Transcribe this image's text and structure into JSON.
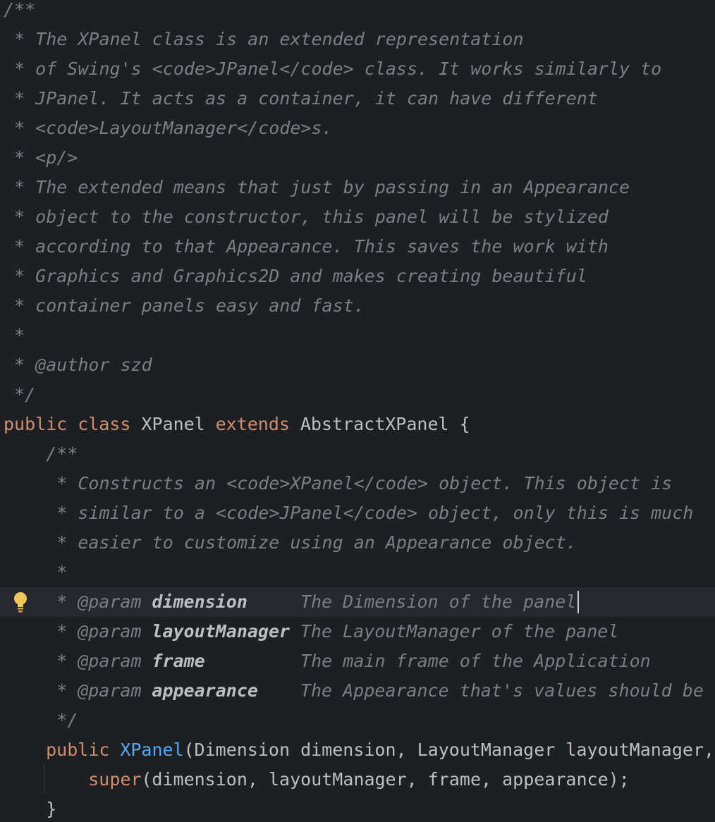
{
  "editor": {
    "language": "Java",
    "lines": [
      {
        "segments": [
          {
            "kind": "doc",
            "text": "/**"
          }
        ]
      },
      {
        "segments": [
          {
            "kind": "doc",
            "text": " * The XPanel class is an extended representation"
          }
        ]
      },
      {
        "segments": [
          {
            "kind": "doc",
            "text": " * of Swing's <code>JPanel</code> class. It works similarly to"
          }
        ]
      },
      {
        "segments": [
          {
            "kind": "doc",
            "text": " * JPanel. It acts as a container, it can have different"
          }
        ]
      },
      {
        "segments": [
          {
            "kind": "doc",
            "text": " * <code>LayoutManager</code>s."
          }
        ]
      },
      {
        "segments": [
          {
            "kind": "doc",
            "text": " * <p/>"
          }
        ]
      },
      {
        "segments": [
          {
            "kind": "doc",
            "text": " * The extended means that just by passing in an Appearance"
          }
        ]
      },
      {
        "segments": [
          {
            "kind": "doc",
            "text": " * object to the constructor, this panel will be stylized"
          }
        ]
      },
      {
        "segments": [
          {
            "kind": "doc",
            "text": " * according to that Appearance. This saves the work with"
          }
        ]
      },
      {
        "segments": [
          {
            "kind": "doc",
            "text": " * Graphics and Graphics2D and makes creating beautiful"
          }
        ]
      },
      {
        "segments": [
          {
            "kind": "doc",
            "text": " * container panels easy and fast."
          }
        ]
      },
      {
        "segments": [
          {
            "kind": "doc",
            "text": " *"
          }
        ]
      },
      {
        "segments": [
          {
            "kind": "doc",
            "text": " * @author szd"
          }
        ]
      },
      {
        "segments": [
          {
            "kind": "doc",
            "text": " */"
          }
        ]
      },
      {
        "segments": [
          {
            "kind": "kw",
            "text": "public"
          },
          {
            "kind": "plain",
            "text": " "
          },
          {
            "kind": "kw",
            "text": "class"
          },
          {
            "kind": "plain",
            "text": " XPanel "
          },
          {
            "kind": "kw",
            "text": "extends"
          },
          {
            "kind": "plain",
            "text": " AbstractXPanel {"
          }
        ]
      },
      {
        "segments": [
          {
            "kind": "doc",
            "text": "    /**"
          }
        ]
      },
      {
        "segments": [
          {
            "kind": "doc",
            "text": "     * Constructs an <code>XPanel</code> object. This object is"
          }
        ]
      },
      {
        "segments": [
          {
            "kind": "doc",
            "text": "     * similar to a <code>JPanel</code> object, only this is much"
          }
        ]
      },
      {
        "segments": [
          {
            "kind": "doc",
            "text": "     * easier to customize using an Appearance object."
          }
        ]
      },
      {
        "segments": [
          {
            "kind": "doc",
            "text": "     *"
          }
        ]
      },
      {
        "current": true,
        "segments": [
          {
            "kind": "doc",
            "text": "     * "
          },
          {
            "kind": "doctag",
            "text": "@param"
          },
          {
            "kind": "doc",
            "text": " "
          },
          {
            "kind": "docparam",
            "text": "dimension"
          },
          {
            "kind": "doc",
            "text": "     The Dimension of the panel"
          }
        ]
      },
      {
        "segments": [
          {
            "kind": "doc",
            "text": "     * "
          },
          {
            "kind": "doctag",
            "text": "@param"
          },
          {
            "kind": "doc",
            "text": " "
          },
          {
            "kind": "docparam",
            "text": "layoutManager"
          },
          {
            "kind": "doc",
            "text": " The LayoutManager of the panel"
          }
        ]
      },
      {
        "segments": [
          {
            "kind": "doc",
            "text": "     * "
          },
          {
            "kind": "doctag",
            "text": "@param"
          },
          {
            "kind": "doc",
            "text": " "
          },
          {
            "kind": "docparam",
            "text": "frame"
          },
          {
            "kind": "doc",
            "text": "         The main frame of the Application"
          }
        ]
      },
      {
        "segments": [
          {
            "kind": "doc",
            "text": "     * "
          },
          {
            "kind": "doctag",
            "text": "@param"
          },
          {
            "kind": "doc",
            "text": " "
          },
          {
            "kind": "docparam",
            "text": "appearance"
          },
          {
            "kind": "doc",
            "text": "    The Appearance that's values should be"
          }
        ]
      },
      {
        "segments": [
          {
            "kind": "doc",
            "text": "     */"
          }
        ]
      },
      {
        "segments": [
          {
            "kind": "plain",
            "text": "    "
          },
          {
            "kind": "kw",
            "text": "public"
          },
          {
            "kind": "plain",
            "text": " "
          },
          {
            "kind": "ctor",
            "text": "XPanel"
          },
          {
            "kind": "plain",
            "text": "(Dimension dimension, LayoutManager layoutManager,"
          }
        ]
      },
      {
        "segments": [
          {
            "kind": "plain",
            "text": "        "
          },
          {
            "kind": "kw",
            "text": "super"
          },
          {
            "kind": "plain",
            "text": "(dimension, layoutManager, frame, appearance);"
          }
        ]
      },
      {
        "segments": [
          {
            "kind": "plain",
            "text": "    }"
          }
        ]
      }
    ],
    "gutter_icon": "lightbulb-icon",
    "colors": {
      "background": "#1e1f22",
      "current_line": "#26282e",
      "doc_comment": "#7a7e85",
      "keyword": "#cf8e6d",
      "identifier": "#bcbec4",
      "constructor": "#56a8f5",
      "bulb": "#f2c55c"
    }
  }
}
